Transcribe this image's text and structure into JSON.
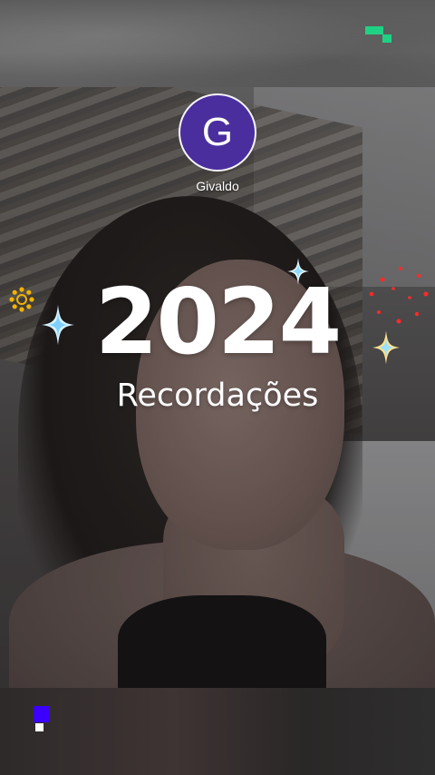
{
  "profile": {
    "initial": "G",
    "name": "Givaldo",
    "avatar_color": "#4a2e9e"
  },
  "headline": {
    "year": "2024",
    "subtitle": "Recordações"
  },
  "decorations": {
    "accent_green": "#1fd183",
    "accent_blue": "#3b00ff",
    "sparkle_color": "#d6f3ff",
    "gold_color": "#f2b200",
    "red_color": "#ff2a2a"
  }
}
